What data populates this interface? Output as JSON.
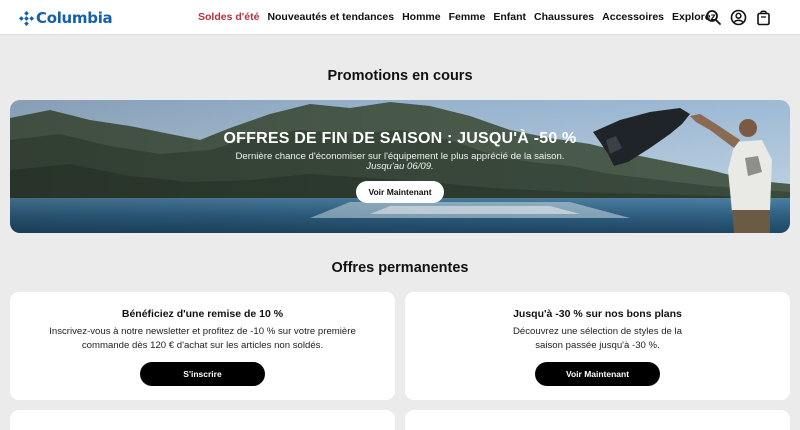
{
  "header": {
    "brand": "Columbia",
    "nav": [
      "Soldes d'été",
      "Nouveautés et tendances",
      "Homme",
      "Femme",
      "Enfant",
      "Chaussures",
      "Accessoires",
      "Explorez"
    ],
    "icons": [
      "search-icon",
      "account-icon",
      "bag-icon"
    ]
  },
  "promotions": {
    "heading": "Promotions en cours",
    "hero": {
      "title": "OFFRES DE FIN DE SAISON : JUSQU'À -50 %",
      "subtitle": "Dernière chance d'économiser sur l'équipement le plus apprécié de la saison.",
      "date": "Jusqu'au 06/09.",
      "button": "Voir Maintenant"
    }
  },
  "permanent": {
    "heading": "Offres permanentes",
    "cards": [
      {
        "title": "Bénéficiez d'une remise de 10 %",
        "line1": "Inscrivez-vous à notre newsletter et profitez de -10 % sur votre première",
        "line2": "commande dès 120 € d'achat sur les articles non soldés.",
        "button": "S'inscrire"
      },
      {
        "title": "Jusqu'à -30 % sur nos bons plans",
        "line1": "Découvrez une sélection de styles de la",
        "line2": "saison passée jusqu'à -30 %.",
        "button": "Voir Maintenant"
      }
    ]
  },
  "colors": {
    "brand_blue": "#1560a8",
    "sale_red": "#b5303a",
    "page_bg": "#ebebeb"
  }
}
